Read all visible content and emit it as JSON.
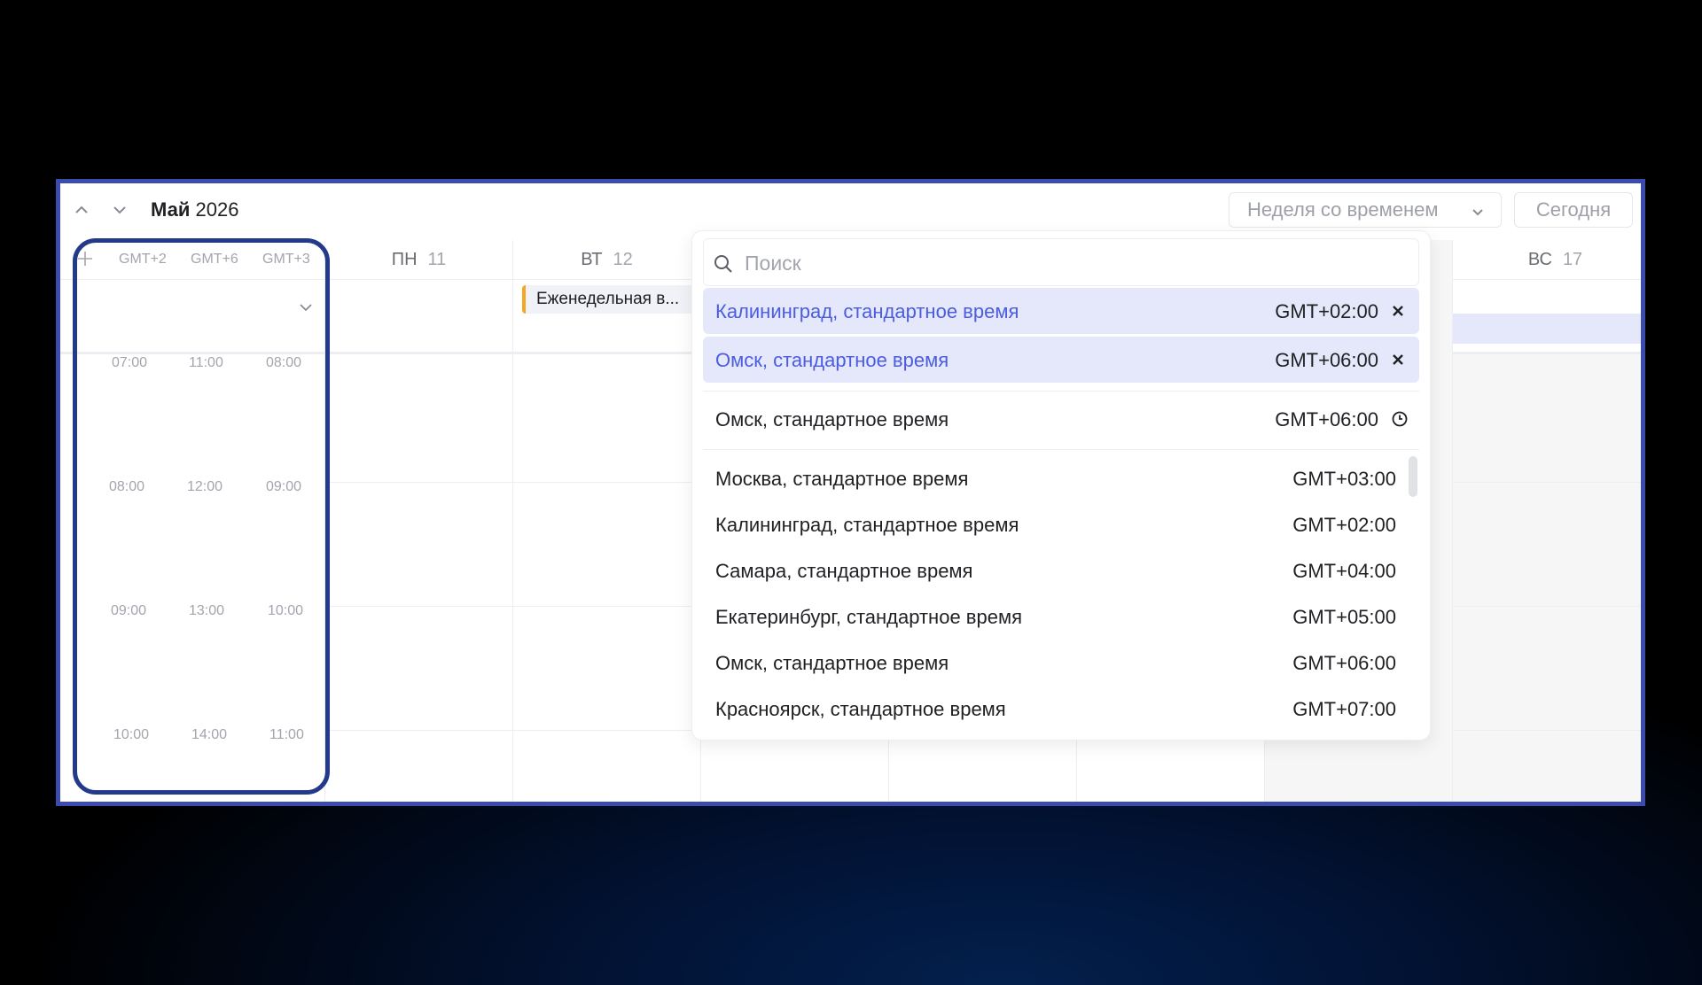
{
  "header": {
    "month": "Май",
    "year": "2026",
    "view_select": "Неделя со временем",
    "today_button": "Сегодня"
  },
  "timezones": {
    "labels": [
      "GMT+2",
      "GMT+6",
      "GMT+3"
    ],
    "rows": [
      [
        "07:00",
        "11:00",
        "08:00"
      ],
      [
        "08:00",
        "12:00",
        "09:00"
      ],
      [
        "09:00",
        "13:00",
        "10:00"
      ],
      [
        "10:00",
        "14:00",
        "11:00"
      ]
    ]
  },
  "days": [
    {
      "name": "ПН",
      "num": "11"
    },
    {
      "name": "ВТ",
      "num": "12"
    },
    {
      "name": "",
      "num": ""
    },
    {
      "name": "",
      "num": ""
    },
    {
      "name": "",
      "num": ""
    },
    {
      "name": "",
      "num": ""
    },
    {
      "name": "ВС",
      "num": "17"
    }
  ],
  "event": {
    "title": "Еженедельная в..."
  },
  "dropdown": {
    "search_placeholder": "Поиск",
    "selected": [
      {
        "name": "Калининград, стандартное время",
        "offset": "GMT+02:00"
      },
      {
        "name": "Омск, стандартное время",
        "offset": "GMT+06:00"
      }
    ],
    "current": {
      "name": "Омск, стандартное время",
      "offset": "GMT+06:00"
    },
    "list": [
      {
        "name": "Москва, стандартное время",
        "offset": "GMT+03:00"
      },
      {
        "name": "Калининград, стандартное время",
        "offset": "GMT+02:00"
      },
      {
        "name": "Самара, стандартное время",
        "offset": "GMT+04:00"
      },
      {
        "name": "Екатеринбург, стандартное время",
        "offset": "GMT+05:00"
      },
      {
        "name": "Омск, стандартное время",
        "offset": "GMT+06:00"
      },
      {
        "name": "Красноярск, стандартное время",
        "offset": "GMT+07:00"
      }
    ]
  },
  "colors": {
    "frame_border": "#3b4cae",
    "highlight_border": "#233a8a",
    "accent_text": "#4a5ce0",
    "selected_bg": "#e5e8fb",
    "event_marker": "#f5a623"
  }
}
